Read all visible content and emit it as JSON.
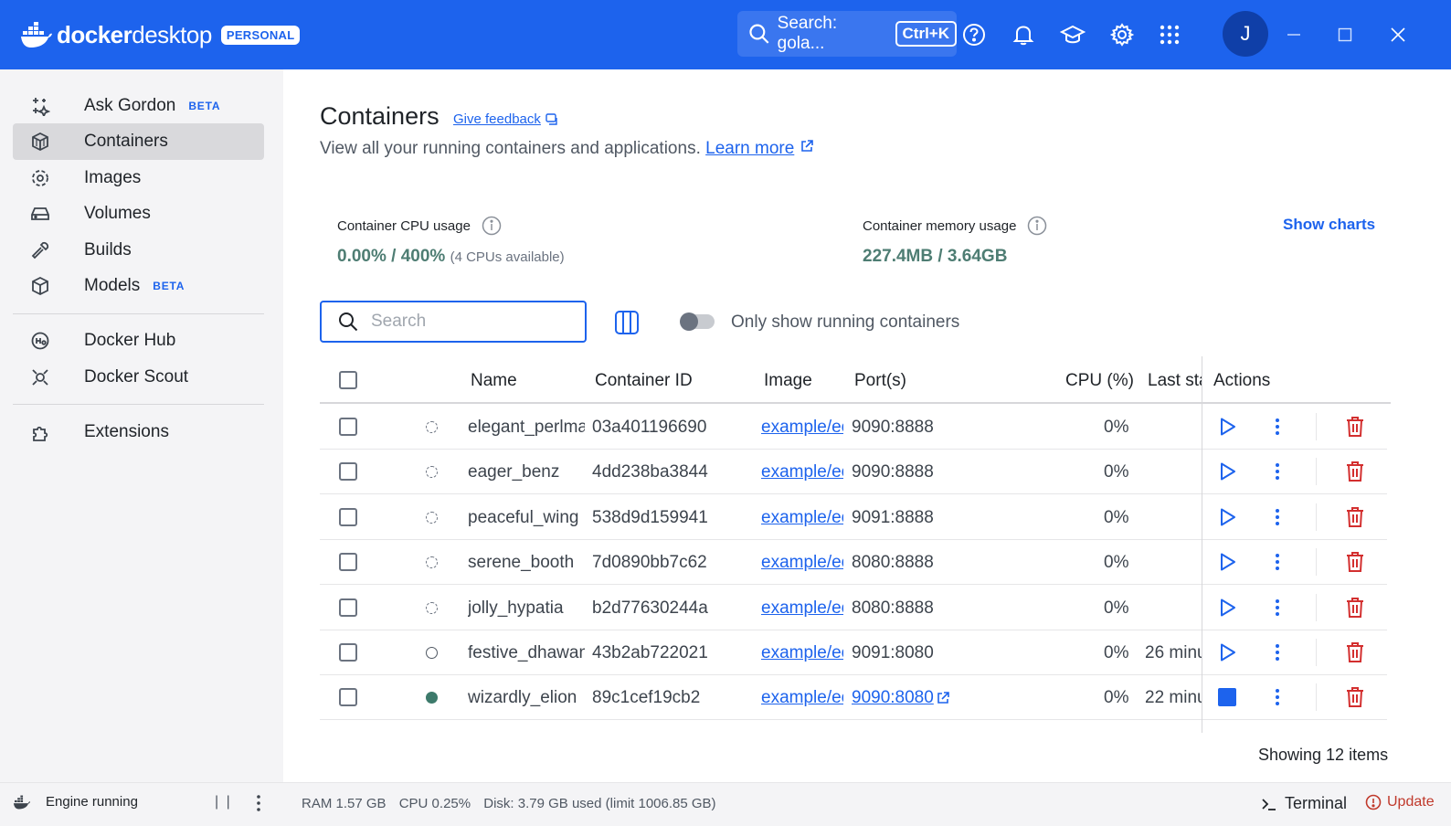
{
  "app": {
    "brand_first": "docker",
    "brand_second": "desktop",
    "plan_badge": "PERSONAL",
    "search_label": "Search: gola...",
    "search_shortcut": "Ctrl+K",
    "user_initial": "J"
  },
  "sidebar": {
    "items": [
      {
        "label": "Ask Gordon",
        "badge": "BETA",
        "icon": "sparkles-icon"
      },
      {
        "label": "Containers",
        "badge": "",
        "icon": "container-icon"
      },
      {
        "label": "Images",
        "badge": "",
        "icon": "image-icon"
      },
      {
        "label": "Volumes",
        "badge": "",
        "icon": "volume-icon"
      },
      {
        "label": "Builds",
        "badge": "",
        "icon": "wrench-icon"
      },
      {
        "label": "Models",
        "badge": "BETA",
        "icon": "cube-icon"
      },
      {
        "label": "Docker Hub",
        "badge": "",
        "icon": "hub-icon"
      },
      {
        "label": "Docker Scout",
        "badge": "",
        "icon": "scout-icon"
      },
      {
        "label": "Extensions",
        "badge": "",
        "icon": "puzzle-icon"
      }
    ]
  },
  "page": {
    "title": "Containers",
    "feedback": "Give feedback",
    "subtitle": "View all your running containers and applications.",
    "learn_more": "Learn more",
    "cpu_label": "Container CPU usage",
    "cpu_value": "0.00% / 400%",
    "cpu_note": "(4 CPUs available)",
    "mem_label": "Container memory usage",
    "mem_value": "227.4MB / 3.64GB",
    "show_charts": "Show charts",
    "search_placeholder": "Search",
    "toggle_label": "Only show running containers",
    "showing": "Showing 12 items"
  },
  "table": {
    "headers": {
      "name": "Name",
      "id": "Container ID",
      "image": "Image",
      "ports": "Port(s)",
      "cpu": "CPU (%)",
      "last_started": "Last sta",
      "actions": "Actions"
    },
    "rows": [
      {
        "name": "elegant_perlmar",
        "id": "03a401196690",
        "image": "example/ec",
        "ports": "9090:8888",
        "cpu": "0%",
        "last": "",
        "status": "created"
      },
      {
        "name": "eager_benz",
        "id": "4dd238ba3844",
        "image": "example/ec",
        "ports": "9090:8888",
        "cpu": "0%",
        "last": "",
        "status": "created"
      },
      {
        "name": "peaceful_wing",
        "id": "538d9d159941",
        "image": "example/ec",
        "ports": "9091:8888",
        "cpu": "0%",
        "last": "",
        "status": "created"
      },
      {
        "name": "serene_booth",
        "id": "7d0890bb7c62",
        "image": "example/ec",
        "ports": "8080:8888",
        "cpu": "0%",
        "last": "",
        "status": "created"
      },
      {
        "name": "jolly_hypatia",
        "id": "b2d77630244a",
        "image": "example/ec",
        "ports": "8080:8888",
        "cpu": "0%",
        "last": "",
        "status": "created"
      },
      {
        "name": "festive_dhawan",
        "id": "43b2ab722021",
        "image": "example/ec",
        "ports": "9091:8080",
        "cpu": "0%",
        "last": "26 minu",
        "status": "exited"
      },
      {
        "name": "wizardly_elion",
        "id": "89c1cef19cb2",
        "image": "example/ec",
        "ports": "9090:8080",
        "cpu": "0%",
        "last": "22 minu",
        "status": "running"
      }
    ]
  },
  "footer": {
    "engine": "Engine running",
    "pause": "| |",
    "ram": "RAM 1.57 GB",
    "cpu": "CPU 0.25%",
    "disk": "Disk: 3.79 GB used (limit 1006.85 GB)",
    "terminal": "Terminal",
    "update": "Update"
  },
  "colors": {
    "brand_blue": "#1d63ed",
    "running_green": "#3d7a6b",
    "delete_red": "#d32f2f"
  }
}
